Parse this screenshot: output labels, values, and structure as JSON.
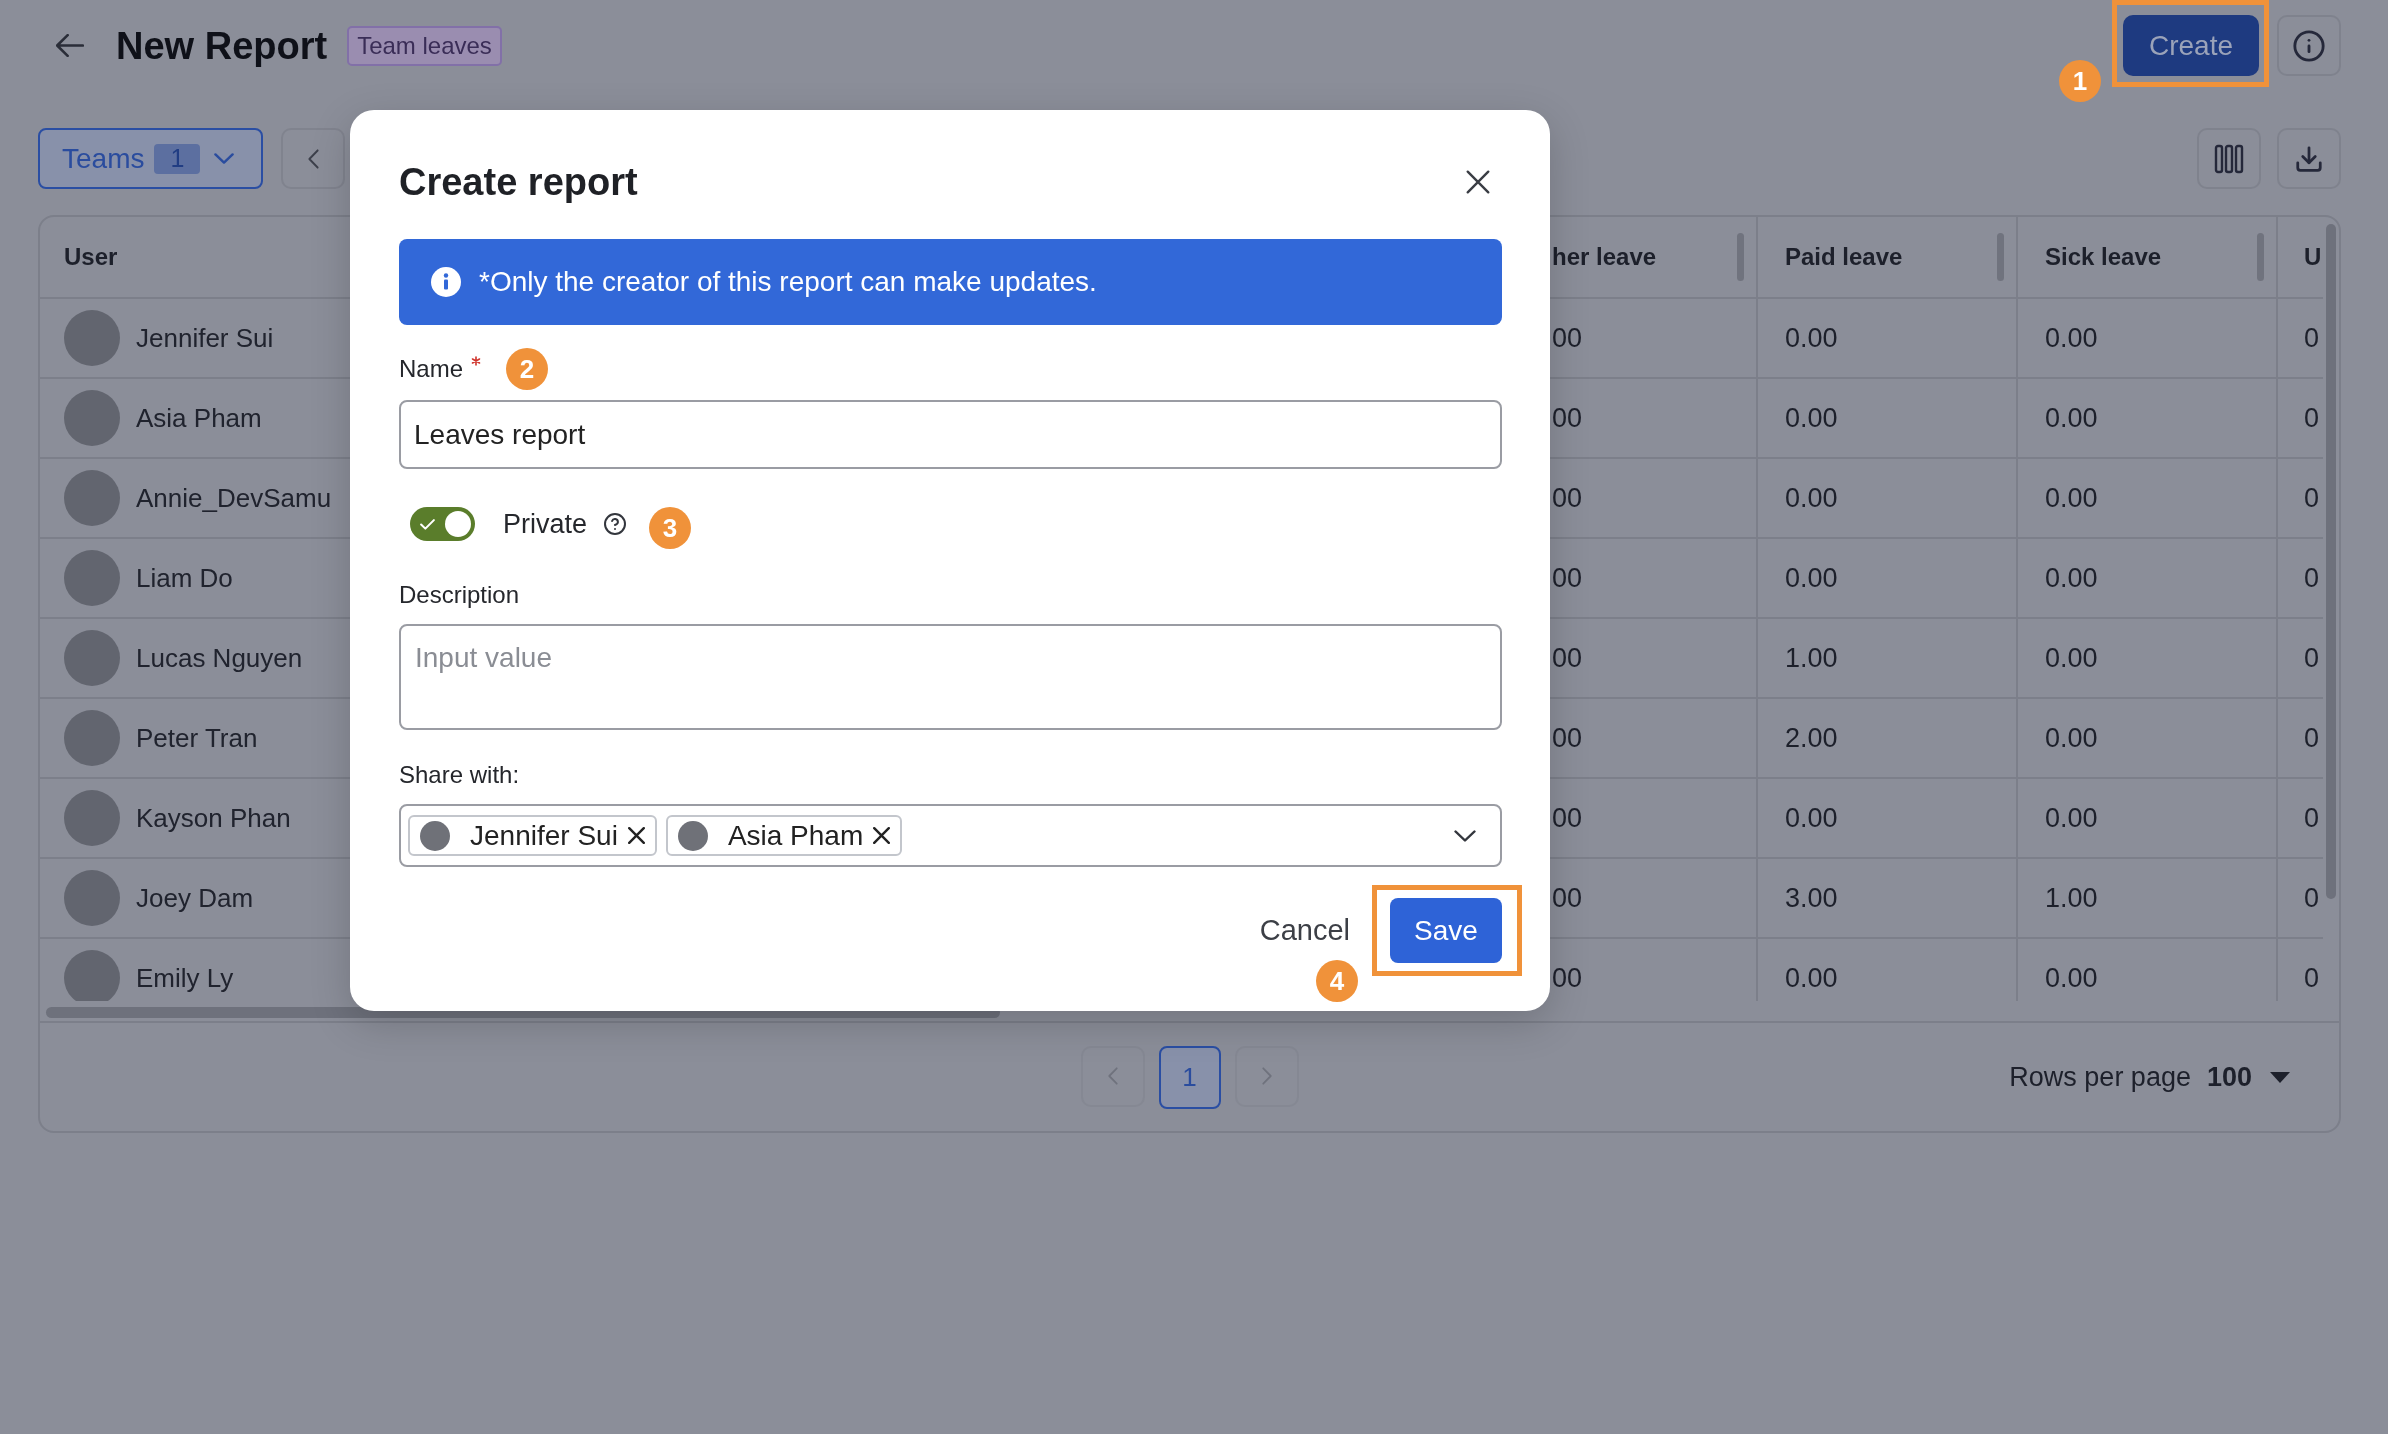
{
  "header": {
    "title": "New Report",
    "tag": "Team leaves",
    "create_button": {
      "label": "Create",
      "highlighted": true,
      "callout": "1"
    }
  },
  "toolbar": {
    "teams_filter": {
      "label": "Teams",
      "count": "1"
    }
  },
  "table": {
    "columns": [
      {
        "label": "User",
        "resizable": false
      },
      {
        "label": "her leave",
        "resizable": true
      },
      {
        "label": "Paid leave",
        "resizable": true
      },
      {
        "label": "Sick leave",
        "resizable": true
      },
      {
        "label": "U",
        "resizable": false
      }
    ],
    "rows": [
      {
        "cells": [
          "Jennifer Sui",
          "00",
          "0.00",
          "0.00",
          "0"
        ]
      },
      {
        "cells": [
          "Asia Pham",
          "00",
          "0.00",
          "0.00",
          "0"
        ]
      },
      {
        "cells": [
          "Annie_DevSamu",
          "00",
          "0.00",
          "0.00",
          "0"
        ]
      },
      {
        "cells": [
          "Liam Do",
          "00",
          "0.00",
          "0.00",
          "0"
        ]
      },
      {
        "cells": [
          "Lucas Nguyen",
          "00",
          "1.00",
          "0.00",
          "0"
        ]
      },
      {
        "cells": [
          "Peter Tran",
          "00",
          "2.00",
          "0.00",
          "0"
        ]
      },
      {
        "cells": [
          "Kayson Phan",
          "00",
          "0.00",
          "0.00",
          "0"
        ]
      },
      {
        "cells": [
          "Joey Dam",
          "00",
          "3.00",
          "1.00",
          "0"
        ]
      },
      {
        "cells": [
          "Emily Ly",
          "00",
          "0.00",
          "0.00",
          "0"
        ]
      }
    ]
  },
  "pagination": {
    "pages": [
      {
        "label": "1",
        "selected": true
      }
    ],
    "rows_per_page_label": "Rows per page",
    "rows_per_page": "100"
  },
  "dialog": {
    "title": "Create report",
    "notice": "*Only the creator of this report can make updates.",
    "fields": [
      {
        "kind": "text",
        "label": "Name",
        "required": true,
        "value": "Leaves report",
        "callout": "2"
      },
      {
        "kind": "toggle",
        "label": "Private",
        "on": true,
        "callout": "3"
      },
      {
        "kind": "textarea",
        "label": "Description",
        "required": false,
        "placeholder": "Input value"
      },
      {
        "kind": "multiselect",
        "label": "Share with:",
        "required": false,
        "chips": [
          "Jennifer Sui",
          "Asia Pham"
        ]
      }
    ],
    "buttons": [
      {
        "kind": "cancel",
        "label": "Cancel",
        "highlighted": false
      },
      {
        "kind": "save",
        "label": "Save",
        "highlighted": true,
        "callout": "4"
      }
    ]
  }
}
